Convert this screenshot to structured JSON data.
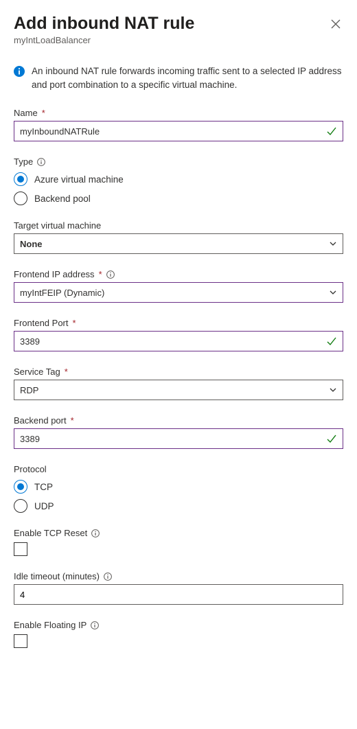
{
  "header": {
    "title": "Add inbound NAT rule",
    "subtitle": "myIntLoadBalancer"
  },
  "info": "An inbound NAT rule forwards incoming traffic sent to a selected IP address and port combination to a specific virtual machine.",
  "fields": {
    "name": {
      "label": "Name",
      "value": "myInboundNATRule"
    },
    "type": {
      "label": "Type",
      "options": {
        "avm": "Azure virtual machine",
        "backend": "Backend pool"
      }
    },
    "targetVm": {
      "label": "Target virtual machine",
      "value": "None"
    },
    "frontendIp": {
      "label": "Frontend IP address",
      "value": "myIntFEIP (Dynamic)"
    },
    "frontendPort": {
      "label": "Frontend Port",
      "value": "3389"
    },
    "serviceTag": {
      "label": "Service Tag",
      "value": "RDP"
    },
    "backendPort": {
      "label": "Backend port",
      "value": "3389"
    },
    "protocol": {
      "label": "Protocol",
      "options": {
        "tcp": "TCP",
        "udp": "UDP"
      }
    },
    "tcpReset": {
      "label": "Enable TCP Reset"
    },
    "idleTimeout": {
      "label": "Idle timeout (minutes)",
      "value": "4"
    },
    "floatingIp": {
      "label": "Enable Floating IP"
    }
  }
}
